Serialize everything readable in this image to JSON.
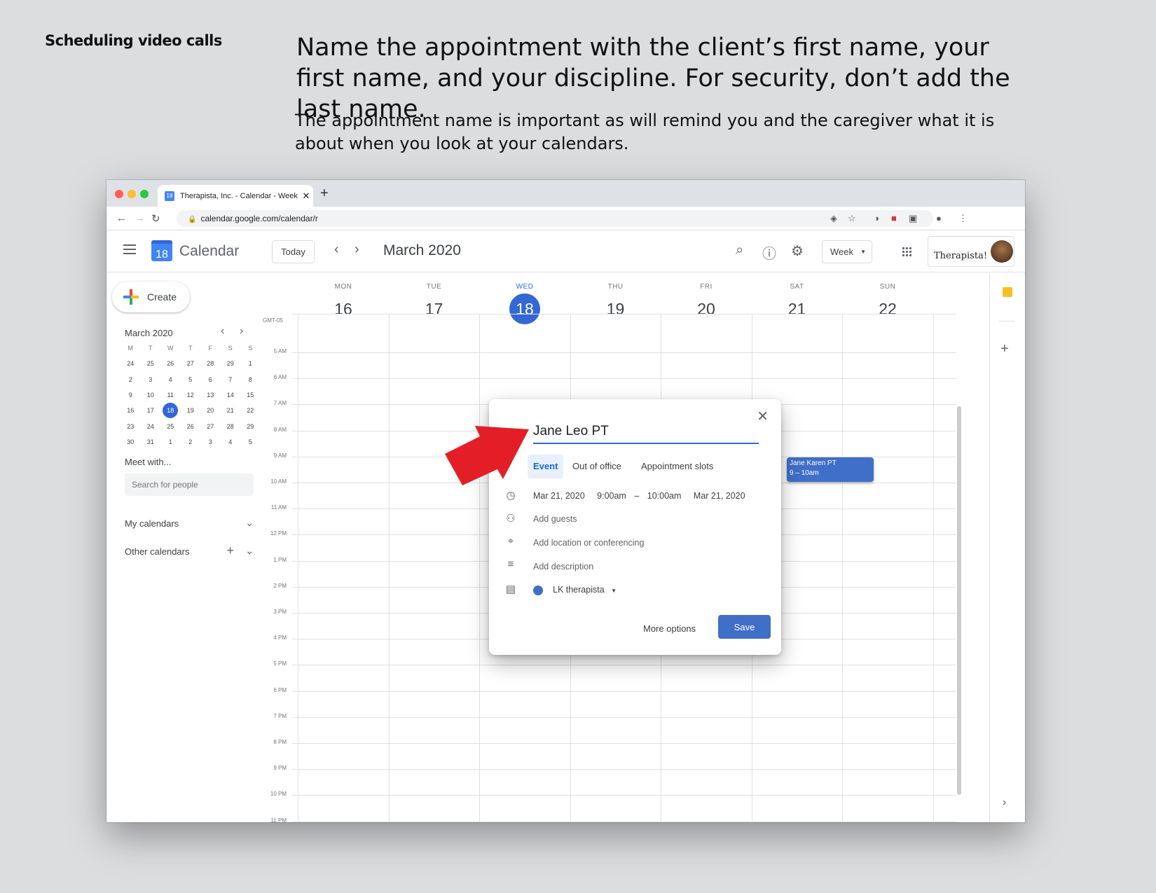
{
  "slide": {
    "section_label": "Scheduling video calls",
    "headline": "Name the appointment with the client’s first name, your first name, and your discipline. For security, don’t add the last name.",
    "subtext": "The appointment name is important as will remind you and the caregiver what it is about when you look at your calendars."
  },
  "browser": {
    "tab_title": "Therapista, Inc. - Calendar - Week",
    "tab_close": "✕",
    "new_tab": "+",
    "url": "calendar.google.com/calendar/r"
  },
  "header": {
    "logo_day": "18",
    "app_name": "Calendar",
    "today_label": "Today",
    "month_title": "March 2020",
    "view_label": "Week",
    "brand_text": "Therapista!"
  },
  "sidebar": {
    "create_label": "Create",
    "mini_month": "March 2020",
    "weekday_initials": [
      "M",
      "T",
      "W",
      "T",
      "F",
      "S",
      "S"
    ],
    "days": [
      "24",
      "25",
      "26",
      "27",
      "28",
      "29",
      "1",
      "2",
      "3",
      "4",
      "5",
      "6",
      "7",
      "8",
      "9",
      "10",
      "11",
      "12",
      "13",
      "14",
      "15",
      "16",
      "17",
      "18",
      "19",
      "20",
      "21",
      "22",
      "23",
      "24",
      "25",
      "26",
      "27",
      "28",
      "29",
      "30",
      "31",
      "1",
      "2",
      "3",
      "4",
      "5"
    ],
    "selected_day": "18",
    "meet_label": "Meet with...",
    "search_placeholder": "Search for people",
    "my_calendars": "My calendars",
    "other_calendars": "Other calendars"
  },
  "week": {
    "days": [
      {
        "name": "MON",
        "date": "16"
      },
      {
        "name": "TUE",
        "date": "17"
      },
      {
        "name": "WED",
        "date": "18",
        "today": true
      },
      {
        "name": "THU",
        "date": "19"
      },
      {
        "name": "FRI",
        "date": "20"
      },
      {
        "name": "SAT",
        "date": "21"
      },
      {
        "name": "SUN",
        "date": "22"
      }
    ],
    "timezone": "GMT-05",
    "hours": [
      "5 AM",
      "6 AM",
      "7 AM",
      "8 AM",
      "9 AM",
      "10 AM",
      "11 AM",
      "12 PM",
      "1 PM",
      "2 PM",
      "3 PM",
      "4 PM",
      "5 PM",
      "6 PM",
      "7 PM",
      "8 PM",
      "9 PM",
      "10 PM",
      "11 PM"
    ]
  },
  "event_chip": {
    "title": "Jane Karen PT",
    "time": "9 – 10am"
  },
  "dialog": {
    "title_value": "Jane Leo PT",
    "tabs": [
      "Event",
      "Out of office",
      "Appointment slots"
    ],
    "start_date": "Mar 21, 2020",
    "start_time": "9:00am",
    "dash": "–",
    "end_time": "10:00am",
    "end_date": "Mar 21, 2020",
    "add_guests": "Add guests",
    "add_location": "Add location or conferencing",
    "add_description": "Add description",
    "calendar_name": "LK therapista",
    "more_options": "More options",
    "save": "Save"
  },
  "colors": {
    "accent": "#3367d6",
    "event": "#3f6fc7",
    "arrow": "#e41e26"
  }
}
